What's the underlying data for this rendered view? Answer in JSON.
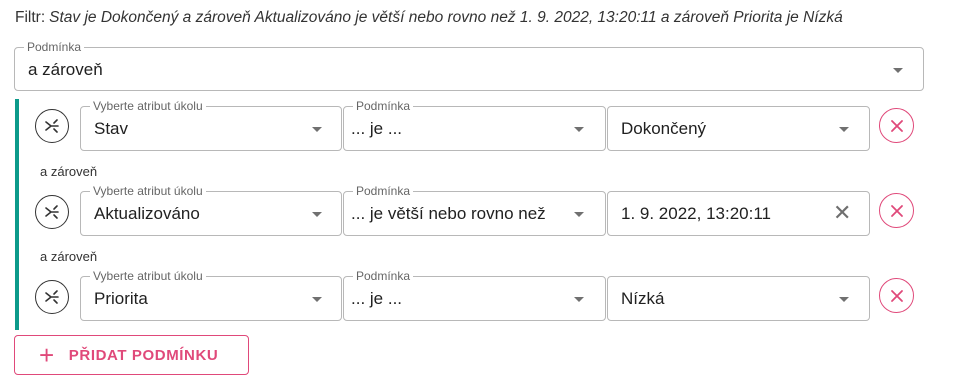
{
  "filter": {
    "prefix": "Filtr:",
    "expression": "Stav je Dokončený a zároveň Aktualizováno je větší nebo rovno než 1. 9. 2022, 13:20:11 a zároveň Priorita je Nízká"
  },
  "top_condition": {
    "label": "Podmínka",
    "value": "a zároveň"
  },
  "join_label": "a zároveň",
  "rows": [
    {
      "attribute": {
        "label": "Vyberte atribut úkolu",
        "value": "Stav"
      },
      "operator": {
        "label": "Podmínka",
        "value": "... je ..."
      },
      "operand": {
        "value": "Dokončený",
        "control": "dropdown"
      }
    },
    {
      "attribute": {
        "label": "Vyberte atribut úkolu",
        "value": "Aktualizováno"
      },
      "operator": {
        "label": "Podmínka",
        "value": "... je větší nebo rovno než"
      },
      "operand": {
        "value": "1. 9. 2022, 13:20:11",
        "control": "clearable-input"
      }
    },
    {
      "attribute": {
        "label": "Vyberte atribut úkolu",
        "value": "Priorita"
      },
      "operator": {
        "label": "Podmínka",
        "value": "... je ..."
      },
      "operand": {
        "value": "Nízká",
        "control": "dropdown"
      }
    }
  ],
  "add_button": {
    "icon": "plus-icon",
    "label": "PŘIDAT PODMÍNKU"
  },
  "colors": {
    "accent": "#e0497a",
    "rail": "#0c9a8a",
    "border": "#b8b8b8"
  }
}
